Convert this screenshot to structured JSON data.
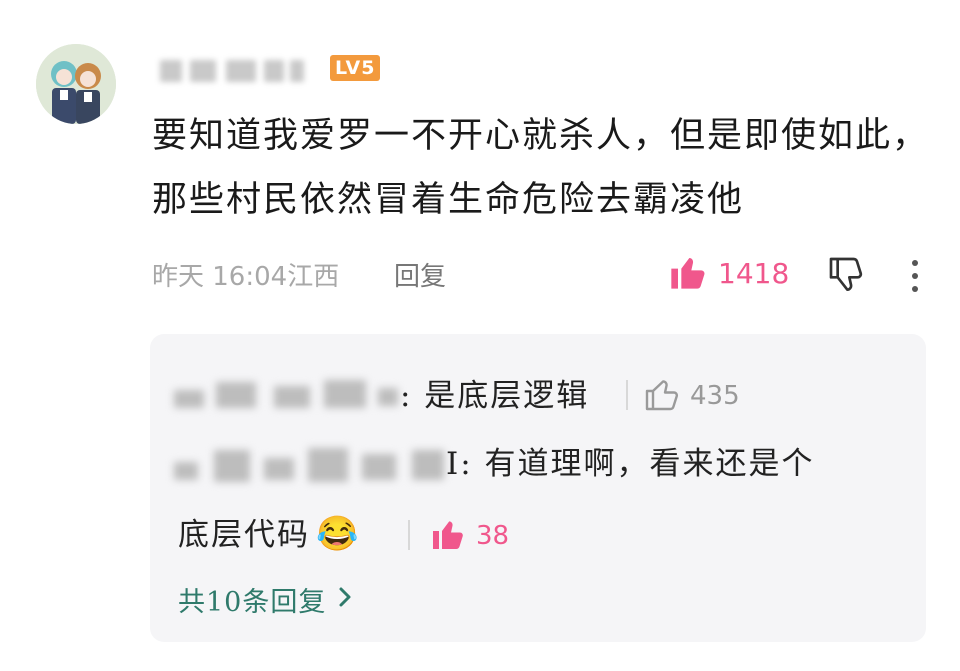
{
  "comment": {
    "level_badge": "LV5",
    "text": "要知道我爱罗一不开心就杀人，但是即使如此，那些村民依然冒着生命危险去霸凌他",
    "time": "昨天 16:04",
    "location": "江西",
    "reply_label": "回复",
    "like_count": "1418"
  },
  "replies": {
    "items": [
      {
        "text": ": 是底层逻辑",
        "like_count": "435"
      },
      {
        "text_line1": "I: 有道理啊，看来还是个",
        "text_line2": "底层代码",
        "emoji": "😂",
        "like_count": "38"
      }
    ],
    "more_label": "共10条回复"
  },
  "colors": {
    "accent_pink": "#f0578c",
    "link_green": "#2f7a6b",
    "badge_orange": "#f39a3d",
    "muted_gray": "#a8a8a8"
  }
}
